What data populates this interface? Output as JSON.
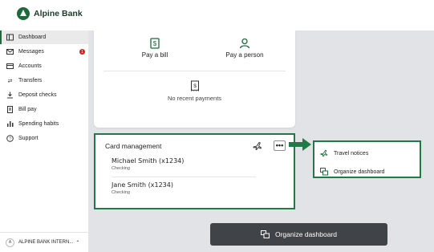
{
  "brand": {
    "name": "Alpine Bank",
    "color": "#1d6b3c"
  },
  "sidebar": {
    "items": [
      {
        "label": "Dashboard",
        "icon": "dashboard-icon",
        "active": true
      },
      {
        "label": "Messages",
        "icon": "mail-icon",
        "badge": "1"
      },
      {
        "label": "Accounts",
        "icon": "accounts-icon"
      },
      {
        "label": "Transfers",
        "icon": "transfer-icon"
      },
      {
        "label": "Deposit checks",
        "icon": "deposit-icon"
      },
      {
        "label": "Bill pay",
        "icon": "bill-icon"
      },
      {
        "label": "Spending habits",
        "icon": "chart-icon"
      },
      {
        "label": "Support",
        "icon": "help-icon"
      }
    ],
    "account": {
      "initial": "A",
      "label": "ALPINE BANK INTERN..."
    }
  },
  "payments": {
    "pay_bill": "Pay a bill",
    "pay_person": "Pay a person",
    "empty_text": "No recent payments"
  },
  "card_management": {
    "title": "Card management",
    "more_label": "•••",
    "accounts": [
      {
        "name": "Michael Smith (x1234)",
        "type": "Checking"
      },
      {
        "name": "Jane Smith (x1234)",
        "type": "Checking"
      }
    ]
  },
  "dropdown": {
    "items": [
      {
        "label": "Travel notices",
        "icon": "plane-icon"
      },
      {
        "label": "Organize dashboard",
        "icon": "organize-icon"
      }
    ]
  },
  "organize_button": {
    "label": "Organize dashboard"
  },
  "colors": {
    "highlight": "#1f7a45",
    "badge": "#d32020",
    "button": "#404348"
  }
}
